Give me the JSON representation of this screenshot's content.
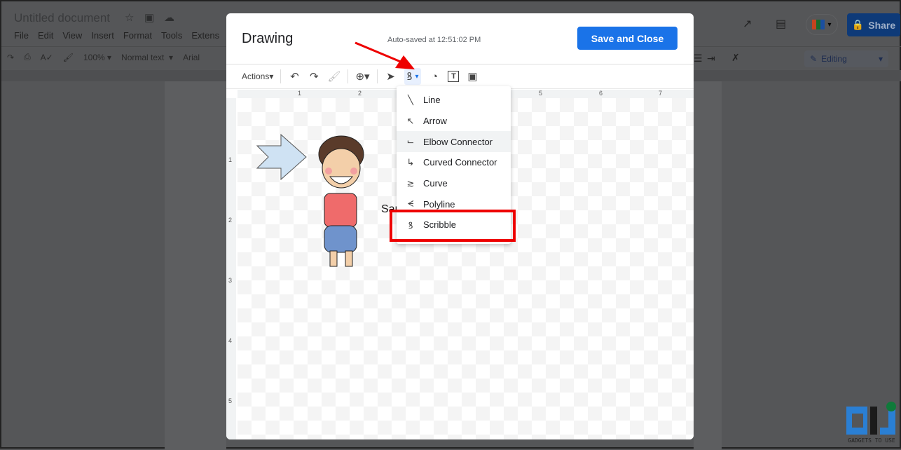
{
  "docs": {
    "title": "Untitled document",
    "menu": [
      "File",
      "Edit",
      "View",
      "Insert",
      "Format",
      "Tools",
      "Extens"
    ],
    "toolbar": {
      "zoom": "100%",
      "style": "Normal text",
      "font": "Arial"
    },
    "share_label": "Share",
    "mode_label": "Editing",
    "share_color": "#0e3a78"
  },
  "dialog": {
    "title": "Drawing",
    "autosave": "Auto-saved at 12:51:02 PM",
    "save_close": "Save and Close",
    "actions_label": "Actions",
    "save_color": "#1a73e8",
    "ruler_h": [
      "1",
      "2",
      "5",
      "6",
      "7"
    ],
    "ruler_v": [
      "1",
      "2",
      "3",
      "4",
      "5"
    ],
    "canvas_text": "Samp",
    "line_menu": [
      {
        "label": "Line",
        "icon": "line-icon"
      },
      {
        "label": "Arrow",
        "icon": "arrow-icon"
      },
      {
        "label": "Elbow Connector",
        "icon": "elbow-connector-icon",
        "hovered": true
      },
      {
        "label": "Curved Connector",
        "icon": "curved-connector-icon"
      },
      {
        "label": "Curve",
        "icon": "curve-icon"
      },
      {
        "label": "Polyline",
        "icon": "polyline-icon"
      },
      {
        "label": "Scribble",
        "icon": "scribble-icon",
        "highlighted": true
      }
    ]
  },
  "watermark": {
    "text": "GADGETS TO USE"
  }
}
